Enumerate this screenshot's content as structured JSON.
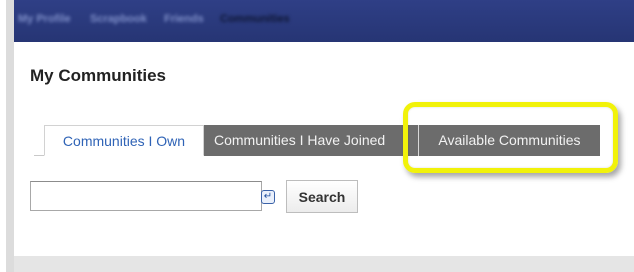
{
  "topnav": {
    "items": [
      {
        "label": "My Profile"
      },
      {
        "label": "Scrapbook"
      },
      {
        "label": "Friends"
      },
      {
        "label": "Communities"
      }
    ]
  },
  "page": {
    "title": "My Communities"
  },
  "tabs": [
    {
      "label": "Communities I Own",
      "selected": true
    },
    {
      "label": "Communities I Have Joined",
      "selected": false
    },
    {
      "label": "Available Communities",
      "selected": false,
      "highlighted": true
    }
  ],
  "search": {
    "value": "",
    "placeholder": "",
    "button_label": "Search"
  },
  "colors": {
    "nav_background": "#2a3a7c",
    "tab_active_text": "#2f63b6",
    "tab_inactive_background": "#6c6c6c",
    "highlight": "#f1f20a"
  },
  "icons": {
    "input_icon": "search-field-icon"
  }
}
